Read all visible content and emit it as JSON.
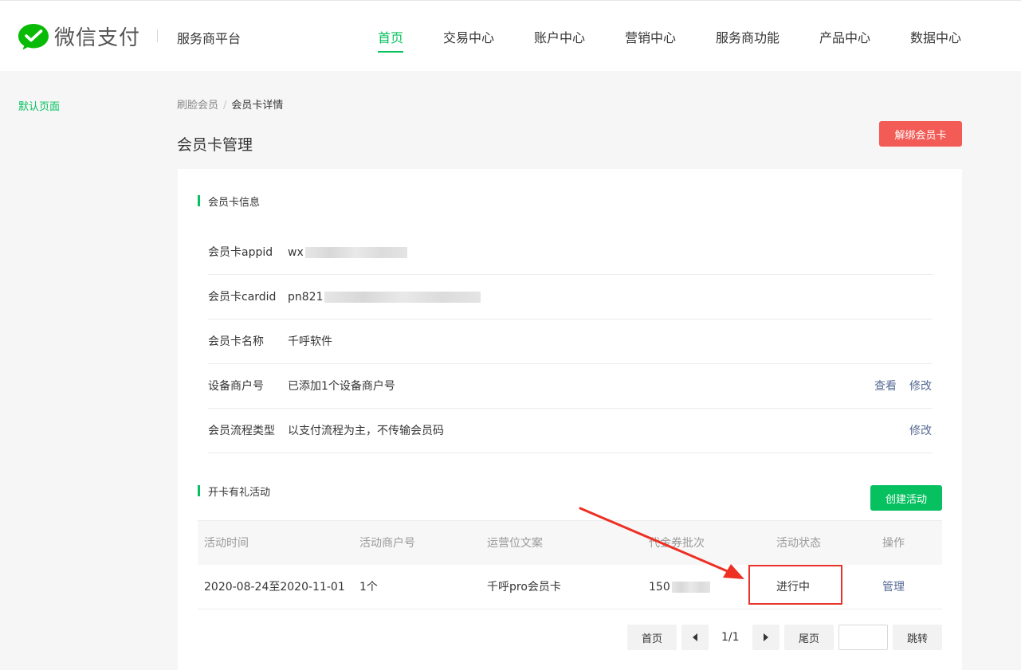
{
  "header": {
    "brand": "微信支付",
    "platform": "服务商平台",
    "nav": [
      {
        "label": "首页",
        "active": true
      },
      {
        "label": "交易中心"
      },
      {
        "label": "账户中心"
      },
      {
        "label": "营销中心"
      },
      {
        "label": "服务商功能"
      },
      {
        "label": "产品中心"
      },
      {
        "label": "数据中心"
      }
    ]
  },
  "sidebar": {
    "items": [
      {
        "label": "默认页面"
      }
    ]
  },
  "breadcrumb": {
    "parent": "刷脸会员",
    "separator": "/",
    "current": "会员卡详情"
  },
  "page": {
    "title": "会员卡管理",
    "unbind_label": "解绑会员卡"
  },
  "card_info": {
    "section_title": "会员卡信息",
    "rows": [
      {
        "label": "会员卡appid",
        "value": "wx"
      },
      {
        "label": "会员卡cardid",
        "value": "pn821"
      },
      {
        "label": "会员卡名称",
        "value": "千呼软件"
      },
      {
        "label": "设备商户号",
        "value": "已添加1个设备商户号",
        "actions": [
          "查看",
          "修改"
        ]
      },
      {
        "label": "会员流程类型",
        "value": "以支付流程为主，不传输会员码",
        "actions": [
          "修改"
        ]
      }
    ]
  },
  "activity": {
    "section_title": "开卡有礼活动",
    "create_label": "创建活动",
    "columns": [
      "活动时间",
      "活动商户号",
      "运营位文案",
      "代金券批次",
      "活动状态",
      "操作"
    ],
    "rows": [
      {
        "time": "2020-08-24至2020-11-01",
        "merchant": "1个",
        "copy": "千呼pro会员卡",
        "batch": "150",
        "status": "进行中",
        "action": "管理"
      }
    ]
  },
  "pager": {
    "first": "首页",
    "page_info": "1/1",
    "last": "尾页",
    "jump": "跳转",
    "prev_icon": "caret-left-icon",
    "next_icon": "caret-right-icon"
  },
  "colors": {
    "brand_green": "#07c160",
    "danger_red": "#f25b56",
    "link_blue": "#576b95",
    "highlight_red": "#e8332b"
  }
}
